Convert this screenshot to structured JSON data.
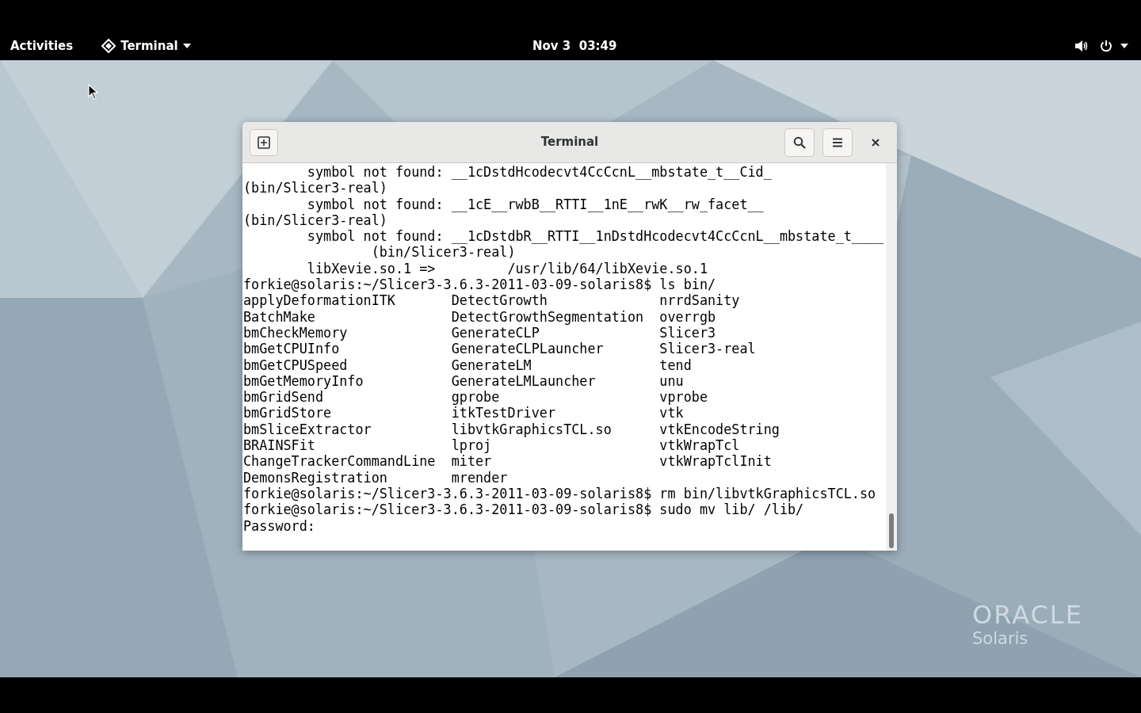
{
  "top_bar": {
    "activities": "Activities",
    "app_menu": "Terminal",
    "clock": "Nov 3  03:49"
  },
  "window": {
    "title": "Terminal",
    "lines": [
      "        symbol not found: __1cDstdHcodecvt4CcCcnL__mbstate_t__Cid_",
      "(bin/Slicer3-real)",
      "        symbol not found: __1cE__rwbB__RTTI__1nE__rwK__rw_facet__",
      "(bin/Slicer3-real)",
      "        symbol not found: __1cDstdbR__RTTI__1nDstdHcodecvt4CcCcnL__mbstate_t____",
      "                (bin/Slicer3-real)",
      "        libXevie.so.1 =>         /usr/lib/64/libXevie.so.1",
      "forkie@solaris:~/Slicer3-3.6.3-2011-03-09-solaris8$ ls bin/",
      "applyDeformationITK       DetectGrowth              nrrdSanity",
      "BatchMake                 DetectGrowthSegmentation  overrgb",
      "bmCheckMemory             GenerateCLP               Slicer3",
      "bmGetCPUInfo              GenerateCLPLauncher       Slicer3-real",
      "bmGetCPUSpeed             GenerateLM                tend",
      "bmGetMemoryInfo           GenerateLMLauncher        unu",
      "bmGridSend                gprobe                    vprobe",
      "bmGridStore               itkTestDriver             vtk",
      "bmSliceExtractor          libvtkGraphicsTCL.so      vtkEncodeString",
      "BRAINSFit                 lproj                     vtkWrapTcl",
      "ChangeTrackerCommandLine  miter                     vtkWrapTclInit",
      "DemonsRegistration        mrender",
      "forkie@solaris:~/Slicer3-3.6.3-2011-03-09-solaris8$ rm bin/libvtkGraphicsTCL.so",
      "forkie@solaris:~/Slicer3-3.6.3-2011-03-09-solaris8$ sudo mv lib/ /lib/",
      "Password:"
    ]
  },
  "wallpaper": {
    "logo": "ORACLE",
    "logo_sub": "Solaris"
  }
}
